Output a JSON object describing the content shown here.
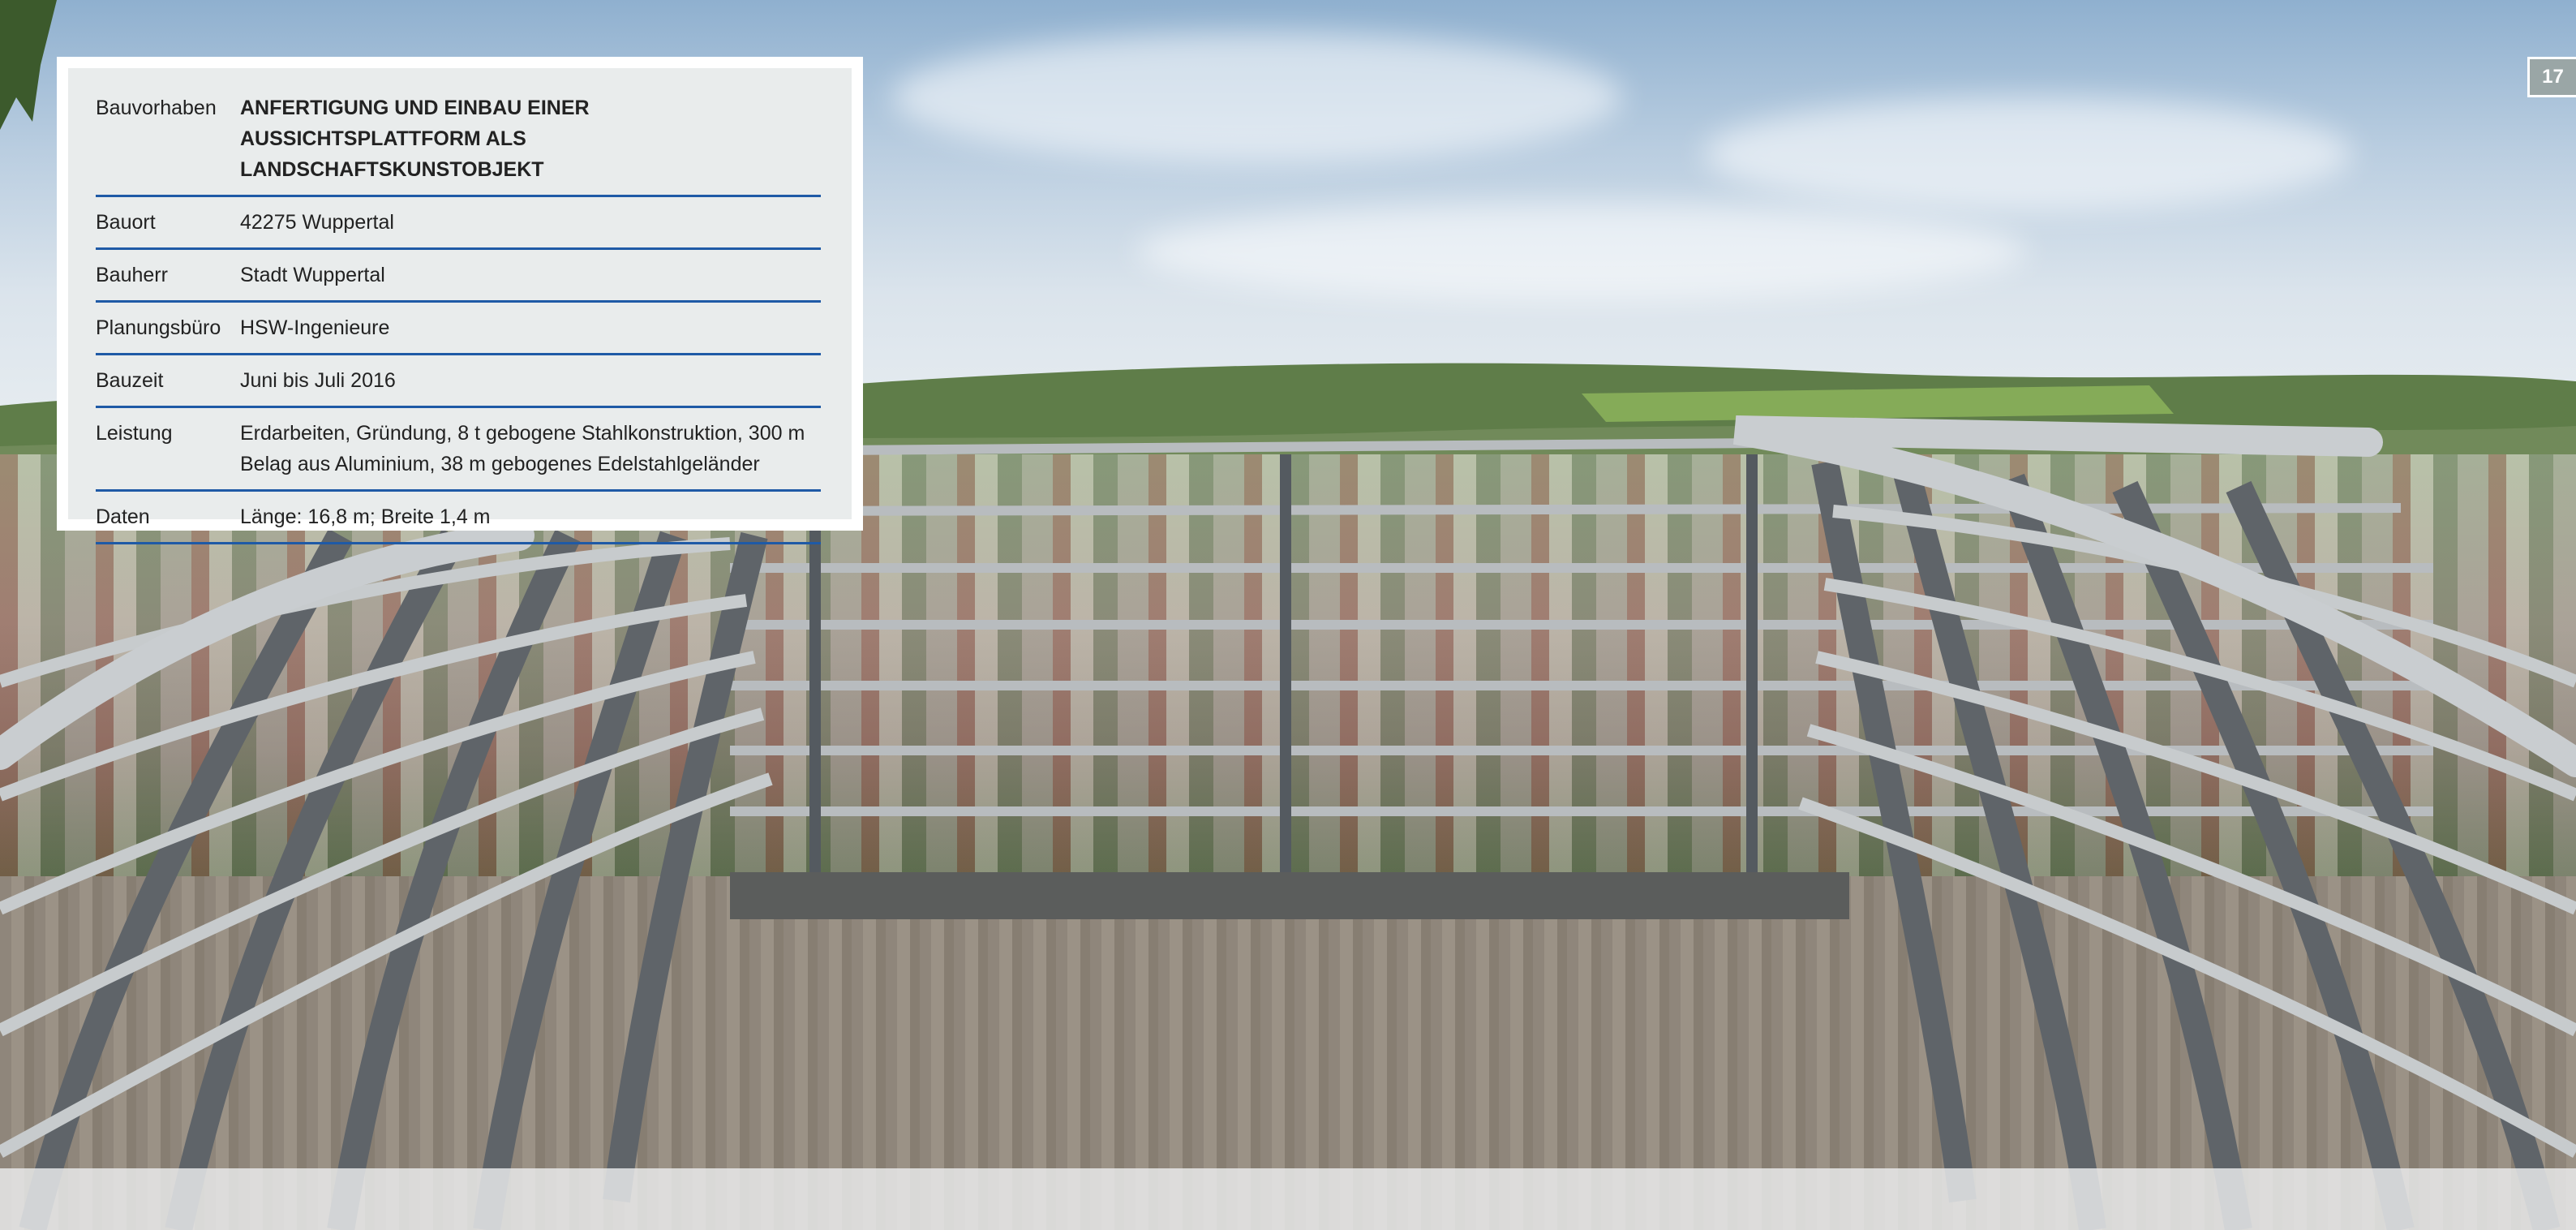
{
  "page_number": "17",
  "project_table": {
    "rows": [
      {
        "label": "Bauvorhaben",
        "value": "ANFERTIGUNG UND EINBAU EINER AUSSICHTSPLATTFORM ALS LANDSCHAFTSKUNSTOBJEKT"
      },
      {
        "label": "Bauort",
        "value": "42275 Wuppertal"
      },
      {
        "label": "Bauherr",
        "value": "Stadt Wuppertal"
      },
      {
        "label": "Planungsbüro",
        "value": "HSW-Ingenieure"
      },
      {
        "label": "Bauzeit",
        "value": "Juni bis Juli 2016"
      },
      {
        "label": "Leistung",
        "value": "Erdarbeiten, Gründung, 8 t gebogene Stahlkonstruktion, 300 m Belag aus Aluminium, 38 m gebogenes Edelstahlgeländer"
      },
      {
        "label": "Daten",
        "value": "Länge: 16,8 m; Breite 1,4 m"
      }
    ]
  },
  "colors": {
    "rule": "#1f5aa6",
    "table_bg": "#e9ecec",
    "page_badge": "#9aa6a6"
  }
}
